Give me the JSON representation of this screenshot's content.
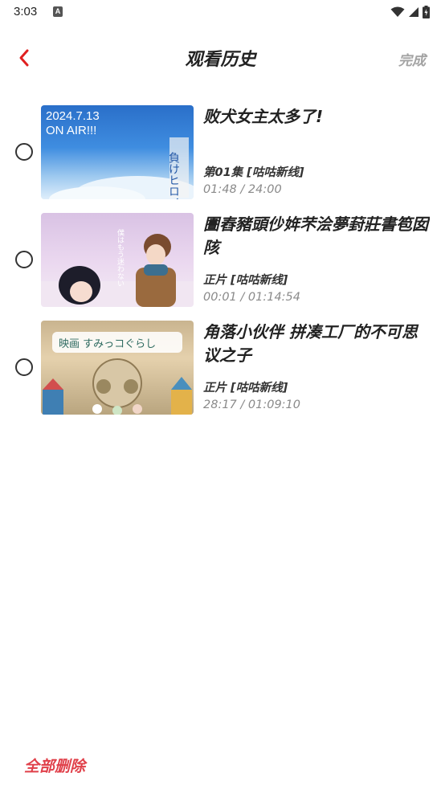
{
  "status_bar": {
    "time": "3:03",
    "notification_glyph": "A"
  },
  "header": {
    "title": "观看历史",
    "done_label": "完成",
    "back_icon": "chevron-left-icon"
  },
  "colors": {
    "accent": "#e0404a",
    "back_arrow": "#e02020"
  },
  "history": [
    {
      "title": "败犬女主太多了!",
      "episode": "第01集 [咕咕新线]",
      "progress": "01:48 / 24:00",
      "thumb_text_1": "2024.7.13",
      "thumb_text_2": "ON AIR!!!",
      "thumb_text_3": "負けヒロイン多すぎ"
    },
    {
      "title": "圕舂豬頭仯姩芣浍夢葑莊書笣囡陔",
      "episode": "正片 [咕咕新线]",
      "progress": "00:01 / 01:14:54"
    },
    {
      "title": "角落小伙伴 拼凑工厂的不可思议之子",
      "episode": "正片 [咕咕新线]",
      "progress": "28:17 / 01:09:10",
      "thumb_text_1": "映画 すみっコぐらし"
    }
  ],
  "footer": {
    "delete_all_label": "全部删除"
  }
}
